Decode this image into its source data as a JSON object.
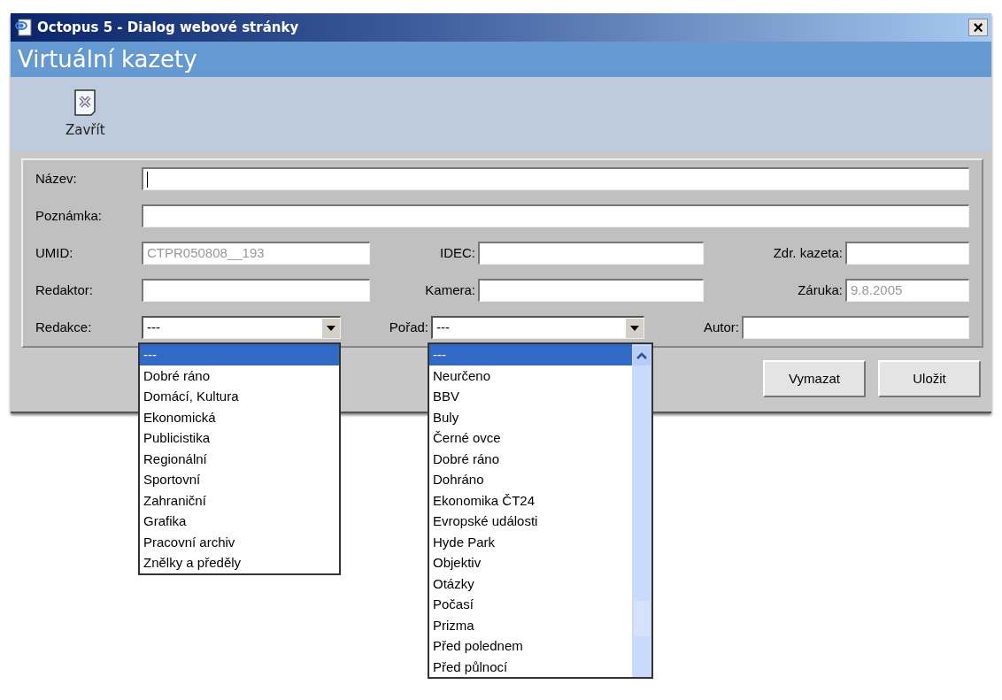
{
  "window": {
    "title": "Octopus 5 - Dialog webové stránky",
    "close": "×"
  },
  "header": {
    "title": "Virtuální kazety"
  },
  "toolbar": [
    {
      "label": "Zavřít"
    }
  ],
  "form": {
    "rows": [
      [
        {
          "label": "Název:",
          "kind": "text",
          "focused": true
        }
      ],
      [
        {
          "label": "Poznámka:",
          "kind": "text",
          "focused": false
        }
      ],
      [
        {
          "label": "UMID:",
          "kind": "text",
          "value": "CTPR050808__193",
          "disabled": true,
          "focused": false
        },
        {
          "label": "IDEC:",
          "kind": "text",
          "focused": false
        },
        {
          "label": "Zdr. kazeta:",
          "kind": "text",
          "focused": false
        }
      ],
      [
        {
          "label": "Redaktor:",
          "kind": "text",
          "focused": false
        },
        {
          "label": "Kamera:",
          "kind": "text",
          "focused": false
        },
        {
          "label": "Záruka:",
          "kind": "text",
          "value": "9.8.2005",
          "disabled": true,
          "focused": false
        }
      ],
      [
        {
          "label": "Redakce:",
          "kind": "select",
          "value": "---",
          "open": true,
          "scrollbar": false,
          "options": [
            {
              "label": "---",
              "selected": true
            },
            {
              "label": "Dobré ráno",
              "selected": false
            },
            {
              "label": "Domácí, Kultura",
              "selected": false
            },
            {
              "label": "Ekonomická",
              "selected": false
            },
            {
              "label": "Publicistika",
              "selected": false
            },
            {
              "label": "Regionální",
              "selected": false
            },
            {
              "label": "Sportovní",
              "selected": false
            },
            {
              "label": "Zahraniční",
              "selected": false
            },
            {
              "label": "Grafika",
              "selected": false
            },
            {
              "label": "Pracovní archiv",
              "selected": false
            },
            {
              "label": "Znělky a předěly",
              "selected": false
            }
          ]
        },
        {
          "label": "Pořad:",
          "kind": "select",
          "value": "---",
          "open": true,
          "scrollbar": true,
          "options": [
            {
              "label": "---",
              "selected": true
            },
            {
              "label": "Neurčeno",
              "selected": false
            },
            {
              "label": "BBV",
              "selected": false
            },
            {
              "label": "Buly",
              "selected": false
            },
            {
              "label": "Černé ovce",
              "selected": false
            },
            {
              "label": "Dobré ráno",
              "selected": false
            },
            {
              "label": "Dohráno",
              "selected": false
            },
            {
              "label": "Ekonomika ČT24",
              "selected": false
            },
            {
              "label": "Evropské události",
              "selected": false
            },
            {
              "label": "Hyde Park",
              "selected": false
            },
            {
              "label": "Objektiv",
              "selected": false
            },
            {
              "label": "Otázky",
              "selected": false
            },
            {
              "label": "Počasí",
              "selected": false
            },
            {
              "label": "Prizma",
              "selected": false
            },
            {
              "label": "Před polednem",
              "selected": false
            },
            {
              "label": "Před půlnocí",
              "selected": false
            }
          ]
        },
        {
          "label": "Autor:",
          "kind": "text",
          "focused": false
        }
      ]
    ]
  },
  "buttons": [
    "Vymazat",
    "Uložit"
  ]
}
